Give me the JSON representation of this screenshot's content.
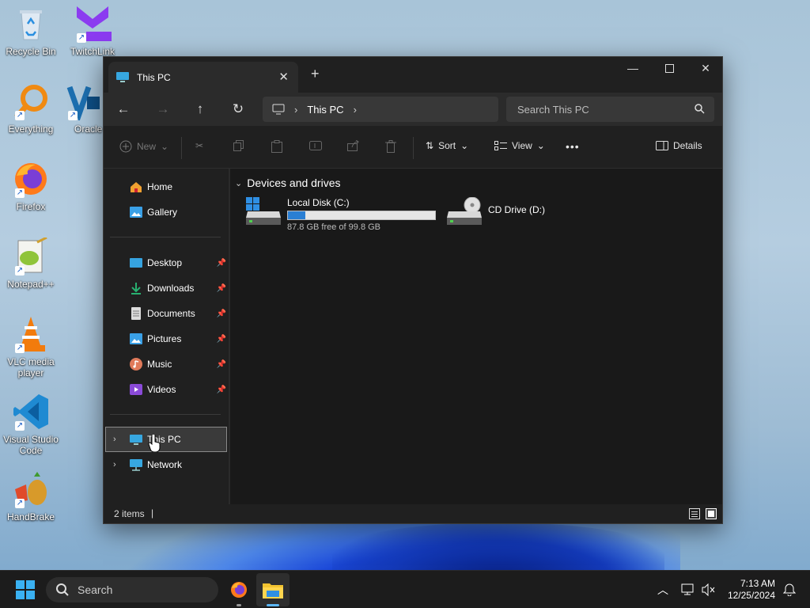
{
  "desktop": {
    "icons": [
      {
        "label": "Recycle Bin"
      },
      {
        "label": "TwitchLink"
      },
      {
        "label": "Everything"
      },
      {
        "label": "Oracle VirtualBox"
      },
      {
        "label": "Firefox"
      },
      {
        "label": "Notepad++"
      },
      {
        "label": "VLC media player"
      },
      {
        "label": "Visual Studio Code"
      },
      {
        "label": "HandBrake"
      }
    ]
  },
  "window": {
    "tab_title": "This PC",
    "address": {
      "crumbs": [
        "This PC"
      ]
    },
    "search_placeholder": "Search This PC",
    "toolbar": {
      "new_label": "New",
      "sort_label": "Sort",
      "view_label": "View",
      "more_label": "•••",
      "details_label": "Details"
    },
    "sidebar": {
      "top": [
        {
          "label": "Home",
          "icon": "home-icon"
        },
        {
          "label": "Gallery",
          "icon": "gallery-icon"
        }
      ],
      "pinned": [
        {
          "label": "Desktop",
          "icon": "desktop-folder-icon"
        },
        {
          "label": "Downloads",
          "icon": "downloads-folder-icon"
        },
        {
          "label": "Documents",
          "icon": "documents-folder-icon"
        },
        {
          "label": "Pictures",
          "icon": "pictures-folder-icon"
        },
        {
          "label": "Music",
          "icon": "music-folder-icon"
        },
        {
          "label": "Videos",
          "icon": "videos-folder-icon"
        }
      ],
      "tree": [
        {
          "label": "This PC",
          "icon": "this-pc-icon",
          "selected": true
        },
        {
          "label": "Network",
          "icon": "network-icon"
        }
      ]
    },
    "content": {
      "group_title": "Devices and drives",
      "drives": [
        {
          "name": "Local Disk (C:)",
          "free_text": "87.8 GB free of 99.8 GB",
          "used_fraction": 0.12
        },
        {
          "name": "CD Drive (D:)"
        }
      ]
    },
    "status": {
      "items": "2 items"
    }
  },
  "taskbar": {
    "search_label": "Search",
    "time": "7:13 AM",
    "date": "12/25/2024"
  },
  "colors": {
    "accent": "#2a7fd4",
    "window_bg": "#191919",
    "taskbar_bg": "#1c1c1c"
  }
}
